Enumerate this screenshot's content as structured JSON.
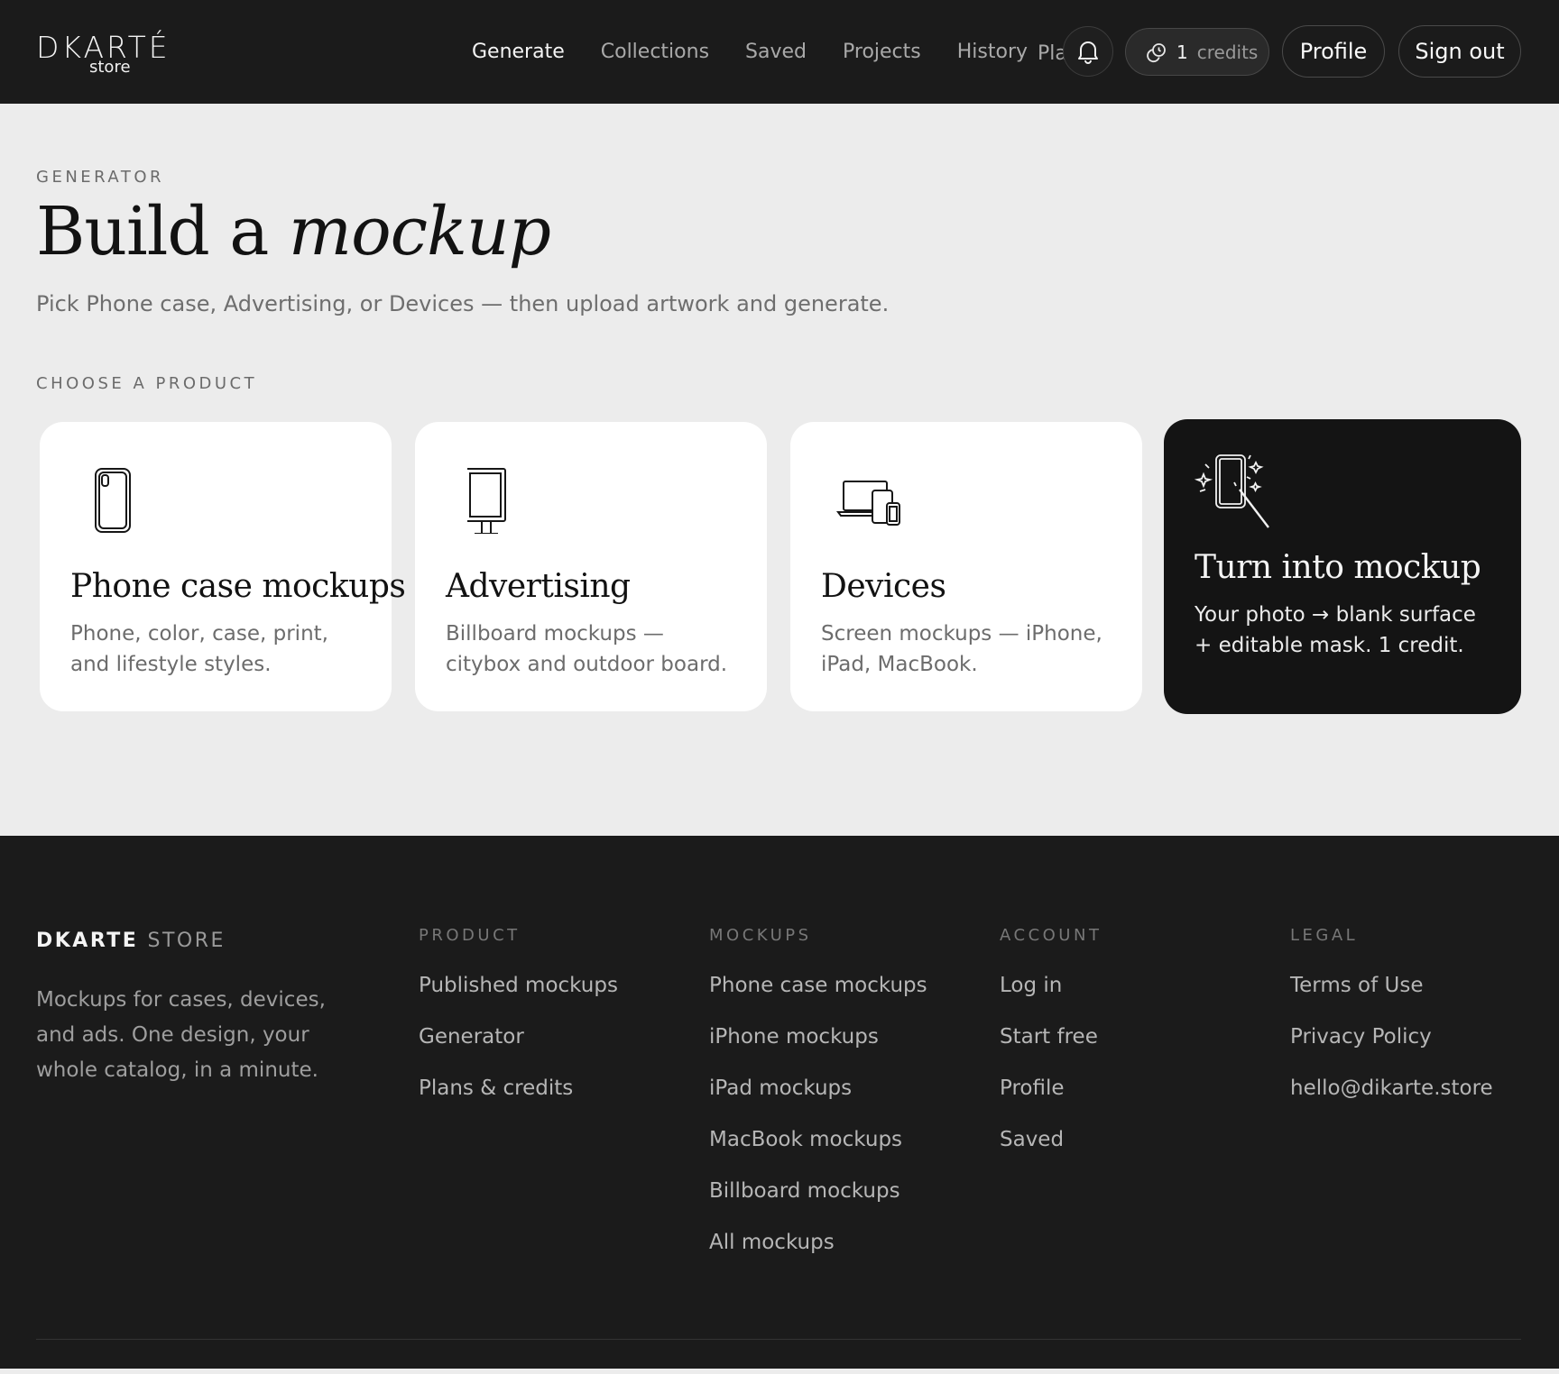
{
  "brand": {
    "logo_main": "DKARTÉ",
    "logo_sub": "store"
  },
  "nav": {
    "items": [
      "Generate",
      "Collections",
      "Saved",
      "Projects",
      "History"
    ],
    "clipped_item": "Plans",
    "active": "Generate"
  },
  "header": {
    "credits_count": "1",
    "credits_label": "credits",
    "profile_label": "Profile",
    "signout_label": "Sign out"
  },
  "hero": {
    "eyebrow": "GENERATOR",
    "title_plain": "Build a",
    "title_italic": "mockup",
    "subtitle": "Pick Phone case, Advertising, or Devices — then upload artwork and generate."
  },
  "products": {
    "eyebrow": "CHOOSE A PRODUCT",
    "cards": [
      {
        "icon": "phone-case-icon",
        "title": "Phone case mockups",
        "desc": "Phone, color, case, print, and lifestyle styles."
      },
      {
        "icon": "billboard-icon",
        "title": "Advertising",
        "desc": "Billboard mockups — citybox and outdoor board."
      },
      {
        "icon": "devices-icon",
        "title": "Devices",
        "desc": "Screen mockups — iPhone, iPad, MacBook."
      },
      {
        "icon": "magic-wand-phone-icon",
        "title": "Turn into mockup",
        "desc": "Your photo → blank surface + editable mask. 1 credit."
      }
    ]
  },
  "footer": {
    "brand_bold": "DKARTE",
    "brand_light": "STORE",
    "description": "Mockups for cases, devices, and ads. One design, your whole catalog, in a minute.",
    "columns": [
      {
        "heading": "PRODUCT",
        "links": [
          "Published mockups",
          "Generator",
          "Plans & credits"
        ]
      },
      {
        "heading": "MOCKUPS",
        "links": [
          "Phone case mockups",
          "iPhone mockups",
          "iPad mockups",
          "MacBook mockups",
          "Billboard mockups",
          "All mockups"
        ]
      },
      {
        "heading": "ACCOUNT",
        "links": [
          "Log in",
          "Start free",
          "Profile",
          "Saved"
        ]
      },
      {
        "heading": "LEGAL",
        "links": [
          "Terms of Use",
          "Privacy Policy",
          "hello@dikarte.store"
        ]
      }
    ]
  },
  "colors": {
    "header_bg": "#1b1b1b",
    "page_bg": "#ececec",
    "card_bg": "#ffffff",
    "accent_dark": "#141414"
  }
}
